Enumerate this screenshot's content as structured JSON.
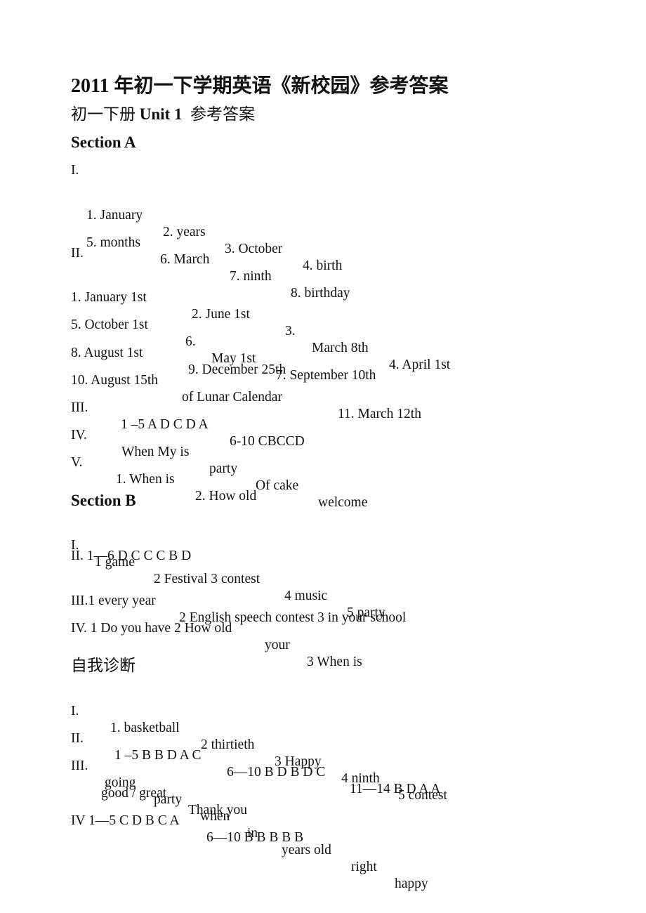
{
  "document": {
    "title": "2011 年初一下学期英语《新校园》参考答案",
    "subtitle_prefix": "初一下册 ",
    "subtitle_unit": "Unit 1",
    "subtitle_suffix": "  参考答案",
    "section_a": {
      "heading": "Section A",
      "part1": {
        "label": "I.",
        "rows": [
          [
            "1. January",
            "2. years",
            "3. October",
            "4. birth"
          ],
          [
            "5. months",
            "6. March",
            "7. ninth",
            "8. birthday"
          ]
        ]
      },
      "part2": {
        "label": "II.",
        "rows": [
          [
            "1. January 1st",
            "2. June 1st",
            "3.",
            "March 8th",
            "4. April 1st"
          ],
          [
            "5. October 1st",
            "6.",
            "May 1st",
            "7. September 10th"
          ],
          [
            "8. August 1st",
            "9. December 25th"
          ],
          [
            "10. August 15th",
            "of Lunar Calendar",
            "11. March 12th"
          ]
        ]
      },
      "part3": {
        "label": "III.",
        "items": [
          "1 –5 A D C D A",
          "6-10 CBCCD"
        ]
      },
      "part4": {
        "label": "IV.",
        "items": [
          "When My is",
          "party",
          "Of cake",
          "welcome"
        ]
      },
      "part5": {
        "label": "V.",
        "items": [
          "1. When is",
          "2. How old"
        ]
      }
    },
    "section_b": {
      "heading": "Section B",
      "part1": {
        "label": "I.",
        "items": [
          "1 game",
          "2 Festival 3 contest",
          "4 music",
          "5 party"
        ]
      },
      "part2": {
        "text": "II. 1—6 D C C C B D"
      },
      "part3": {
        "items": [
          "III.1 every year",
          "2 English speech contest 3 in your school"
        ]
      },
      "part4": {
        "items": [
          "IV. 1 Do you have 2 How old",
          "your",
          "3 When is"
        ]
      }
    },
    "self_diagnosis": {
      "heading": "自我诊断",
      "part1": {
        "label": "I.",
        "items": [
          "1. basketball",
          "2 thirtieth",
          "3 Happy",
          "4 ninth",
          "5 contest"
        ]
      },
      "part2": {
        "label": "II.",
        "items": [
          "1 –5 B B D A C",
          "6—10 B D B D C",
          "11—14 B D A A"
        ]
      },
      "part3": {
        "label": "III.",
        "items": [
          "going",
          "party",
          "when",
          "in",
          "years old",
          "right",
          "happy"
        ],
        "continuation": [
          "good / great",
          "Thank you"
        ]
      },
      "part4": {
        "items": [
          "IV 1—5 C D B C A",
          "6—10 B B B B B"
        ]
      }
    }
  }
}
